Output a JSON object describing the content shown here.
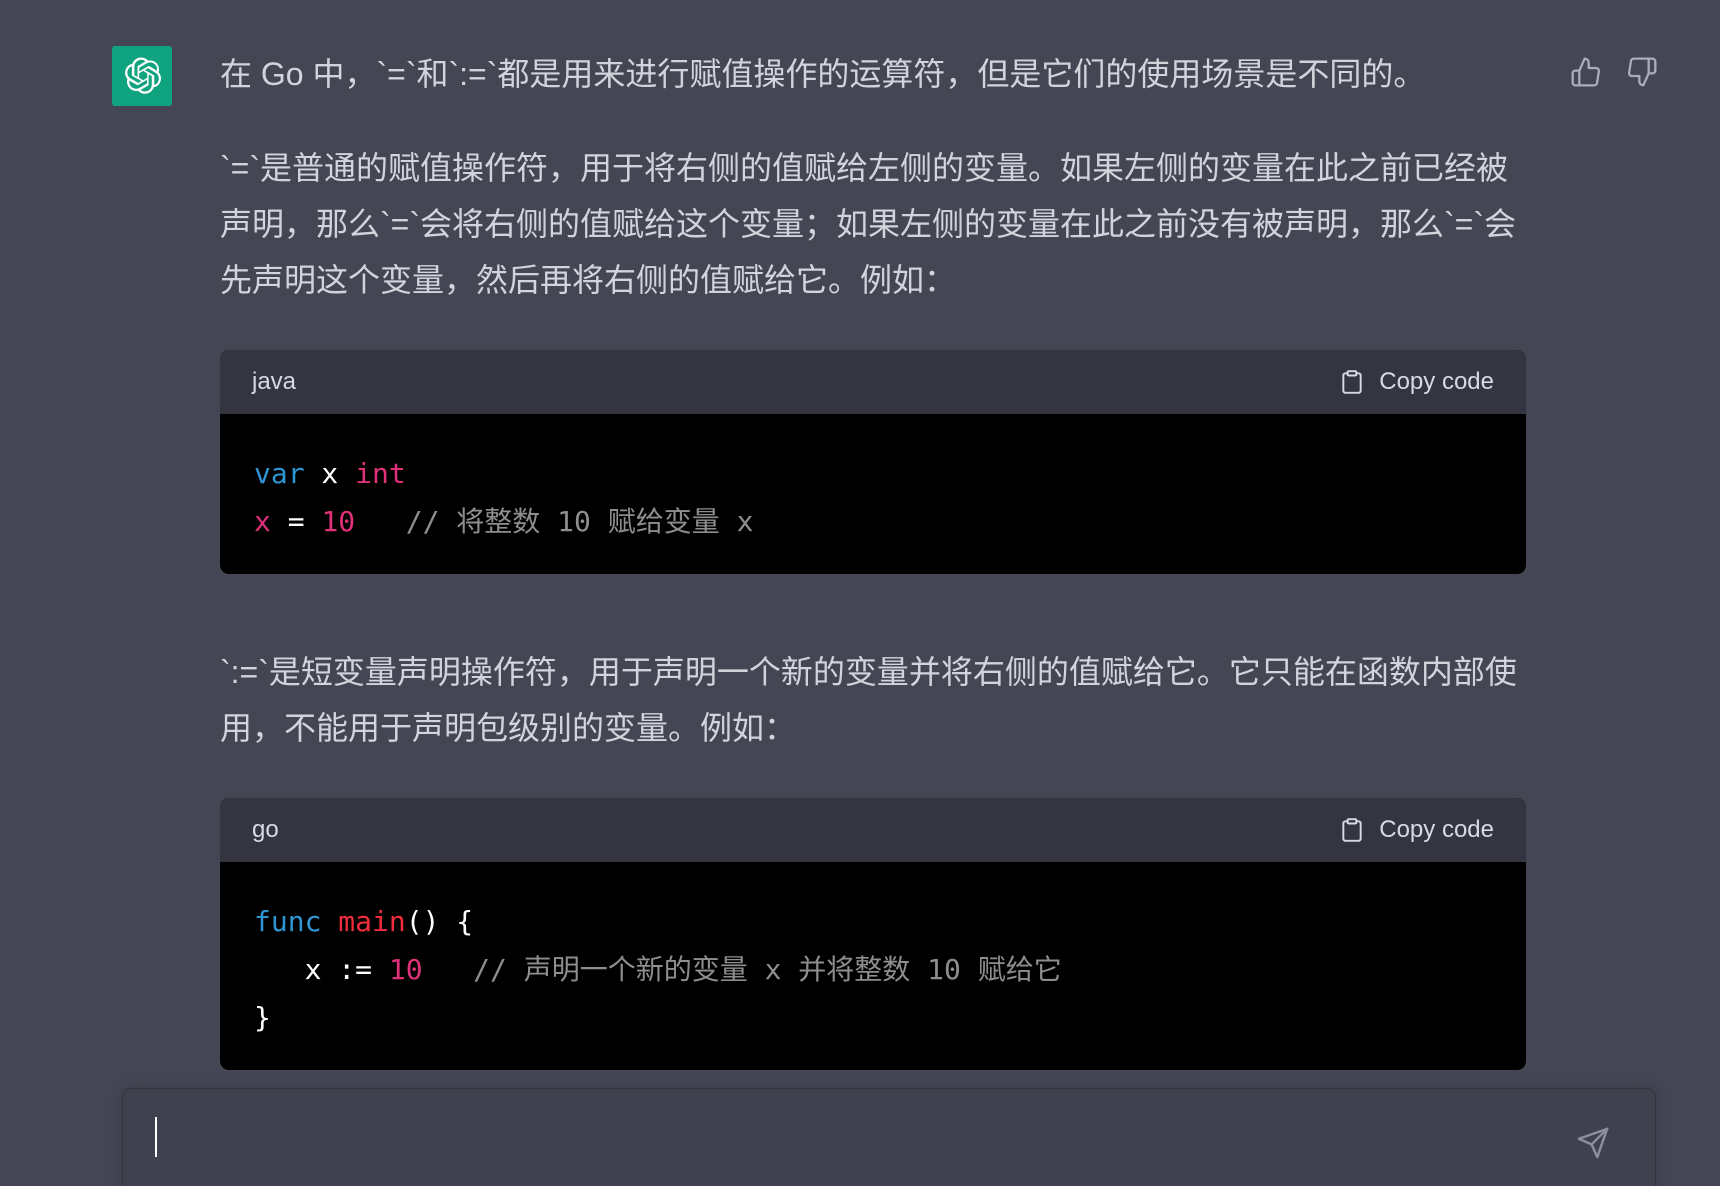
{
  "message": {
    "paragraph_1": "在 Go 中，`=`和`:=`都是用来进行赋值操作的运算符，但是它们的使用场景是不同的。",
    "paragraph_2": "`=`是普通的赋值操作符，用于将右侧的值赋给左侧的变量。如果左侧的变量在此之前已经被声明，那么`=`会将右侧的值赋给这个变量；如果左侧的变量在此之前没有被声明，那么`=`会先声明这个变量，然后再将右侧的值赋给它。例如：",
    "paragraph_3": "`:=`是短变量声明操作符，用于声明一个新的变量并将右侧的值赋给它。它只能在函数内部使用，不能用于声明包级别的变量。例如："
  },
  "code_blocks": [
    {
      "language": "java",
      "copy_label": "Copy code",
      "lines": {
        "l1_kw": "var",
        "l1_name": " x ",
        "l1_type": "int",
        "l2_var": "x",
        "l2_op": " = ",
        "l2_num": "10",
        "l2_comment": "   // 将整数 10 赋给变量 x"
      }
    },
    {
      "language": "go",
      "copy_label": "Copy code",
      "lines": {
        "l1_kw": "func",
        "l1_fn": " main",
        "l1_rest": "() {",
        "l2_pre": "   x := ",
        "l2_num": "10",
        "l2_comment": "   // 声明一个新的变量 x 并将整数 10 赋给它",
        "l3": "}"
      }
    }
  ],
  "icons": {
    "avatar": "openai-logo-icon",
    "thumbs_up": "thumbs-up-icon",
    "thumbs_down": "thumbs-down-icon",
    "clipboard": "clipboard-icon",
    "send": "send-icon"
  },
  "colors": {
    "background": "#444654",
    "avatar_bg": "#10a37f",
    "code_bg": "#000000",
    "code_header_bg": "#343541",
    "keyword": "#2e95d3",
    "number": "#df3079",
    "function": "#f22c3d",
    "comment": "#8e8e8e"
  },
  "input": {
    "value": "",
    "placeholder": ""
  }
}
